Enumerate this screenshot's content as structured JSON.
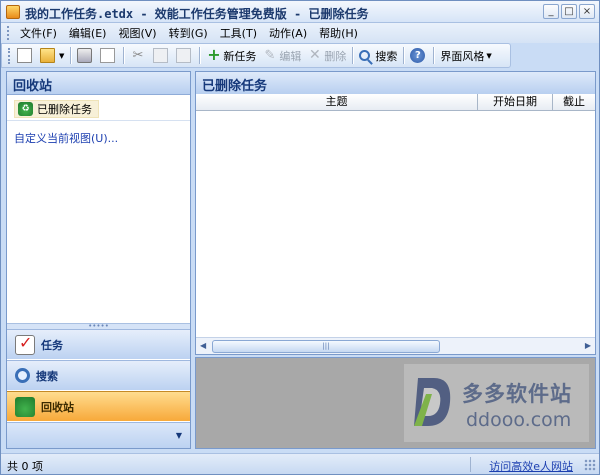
{
  "window": {
    "title": "我的工作任务.etdx - 效能工作任务管理免费版 - 已删除任务",
    "controls": [
      "_",
      "□",
      "×"
    ]
  },
  "menu": [
    "文件(F)",
    "编辑(E)",
    "视图(V)",
    "转到(G)",
    "工具(T)",
    "动作(A)",
    "帮助(H)"
  ],
  "toolbar": {
    "new_task": "新任务",
    "edit": "编辑",
    "delete": "删除",
    "search": "搜索",
    "help": "?",
    "theme": "界面风格"
  },
  "left_panel": {
    "title": "回收站",
    "selected_item": "已删除任务",
    "custom_view_link": "自定义当前视图(U)...",
    "nav": [
      {
        "label": "任务",
        "icon": "task-icon"
      },
      {
        "label": "搜索",
        "icon": "search-icon"
      },
      {
        "label": "回收站",
        "icon": "recycle-icon"
      }
    ]
  },
  "right_panel": {
    "title": "已删除任务",
    "columns": [
      "主题",
      "开始日期",
      "截止"
    ]
  },
  "watermark": {
    "text1": "多多软件站",
    "text2": "ddooo.com"
  },
  "status": {
    "count": "共 0 项",
    "link": "访问高效e人网站"
  },
  "colors": {
    "accent": "#15387a",
    "active_nav": "#f7a93a",
    "link": "#1c3fb0"
  }
}
